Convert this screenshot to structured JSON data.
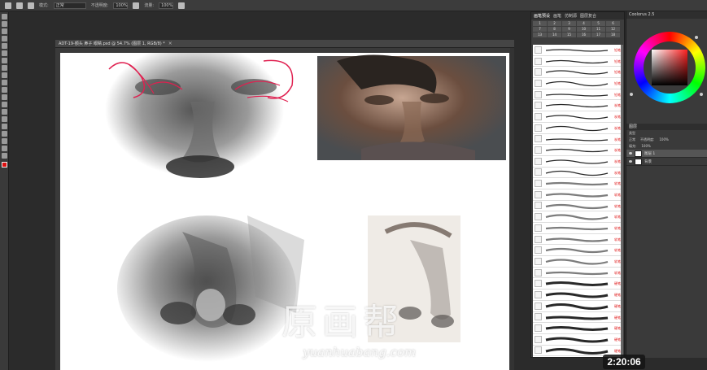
{
  "options_bar": {
    "mode_label": "模式:",
    "mode_value": "正常",
    "opacity_label": "不透明度:",
    "opacity_value": "100%",
    "flow_label": "流量:",
    "flow_value": "100%"
  },
  "document": {
    "tab_title": "ADT-19-额头 鼻子 眼睛.psd @ 54.7% (图层 1, RGB/8) *"
  },
  "brush_panel": {
    "tabs_header": [
      "画笔预设",
      "画笔",
      "仿制源",
      "图层复合"
    ],
    "category_tabs": [
      "1",
      "2",
      "3",
      "4",
      "5",
      "6",
      "7",
      "8",
      "9",
      "10",
      "11",
      "12",
      "13",
      "14",
      "15",
      "16",
      "17",
      "18"
    ],
    "brushes": [
      {
        "tag": "铅笔"
      },
      {
        "tag": "铅笔"
      },
      {
        "tag": "铅笔"
      },
      {
        "tag": "铅笔"
      },
      {
        "tag": "铅笔"
      },
      {
        "tag": "炭笔"
      },
      {
        "tag": "炭笔"
      },
      {
        "tag": "炭笔"
      },
      {
        "tag": "炭笔"
      },
      {
        "tag": "炭笔"
      },
      {
        "tag": "炭笔"
      },
      {
        "tag": "炭笔"
      },
      {
        "tag": "软笔"
      },
      {
        "tag": "软笔"
      },
      {
        "tag": "软笔"
      },
      {
        "tag": "软笔"
      },
      {
        "tag": "软笔"
      },
      {
        "tag": "软笔"
      },
      {
        "tag": "软笔"
      },
      {
        "tag": "软笔"
      },
      {
        "tag": "软笔"
      },
      {
        "tag": "硬笔"
      },
      {
        "tag": "硬笔"
      },
      {
        "tag": "硬笔"
      },
      {
        "tag": "硬笔"
      },
      {
        "tag": "硬笔"
      },
      {
        "tag": "硬笔"
      },
      {
        "tag": "硬笔"
      }
    ]
  },
  "color_panel": {
    "title": "Coolorus 2.5"
  },
  "layers_panel": {
    "title": "图层",
    "kind_label": "类型",
    "blend_mode": "正常",
    "opacity_label": "不透明度:",
    "opacity_value": "100%",
    "fill_label": "填充:",
    "fill_value": "100%",
    "layers": [
      {
        "name": "图层 1",
        "selected": true
      },
      {
        "name": "背景",
        "selected": false
      }
    ]
  },
  "video": {
    "timestamp": "2:20:06"
  },
  "watermark": {
    "text_cn": "原画帮",
    "url": "yuanhuabang.com"
  },
  "colors": {
    "foreground": "#dd1111",
    "annotation_red": "#e02020",
    "panel_bg": "#3d3d3d",
    "canvas_bg": "#ffffff"
  }
}
